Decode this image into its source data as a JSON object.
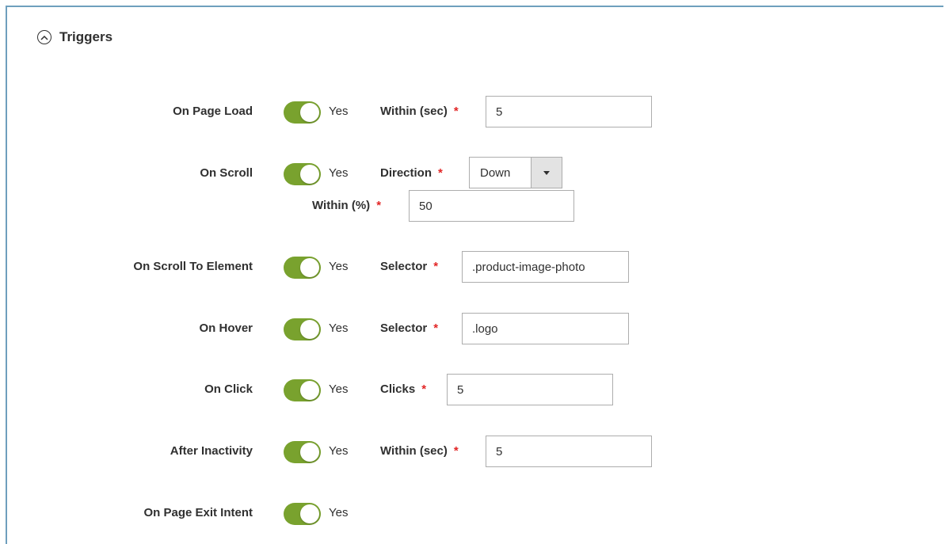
{
  "section": {
    "title": "Triggers",
    "icon": "chevron-up-circle-icon"
  },
  "colors": {
    "toggle_on": "#79a22e",
    "required": "#e22626",
    "panel_border": "#6e9fbd"
  },
  "triggers": [
    {
      "label": "On Page Load",
      "enabled": "Yes",
      "field_label": "Within (sec)",
      "value": "5"
    },
    {
      "label": "On Scroll",
      "enabled": "Yes",
      "field_label": "Direction",
      "select_value": "Down",
      "field2_label": "Within (%)",
      "value2": "50"
    },
    {
      "label": "On Scroll To Element",
      "enabled": "Yes",
      "field_label": "Selector",
      "value": ".product-image-photo"
    },
    {
      "label": "On Hover",
      "enabled": "Yes",
      "field_label": "Selector",
      "value": ".logo"
    },
    {
      "label": "On Click",
      "enabled": "Yes",
      "field_label": "Clicks",
      "value": "5"
    },
    {
      "label": "After Inactivity",
      "enabled": "Yes",
      "field_label": "Within (sec)",
      "value": "5"
    },
    {
      "label": "On Page Exit Intent",
      "enabled": "Yes"
    }
  ],
  "required_mark": "*"
}
